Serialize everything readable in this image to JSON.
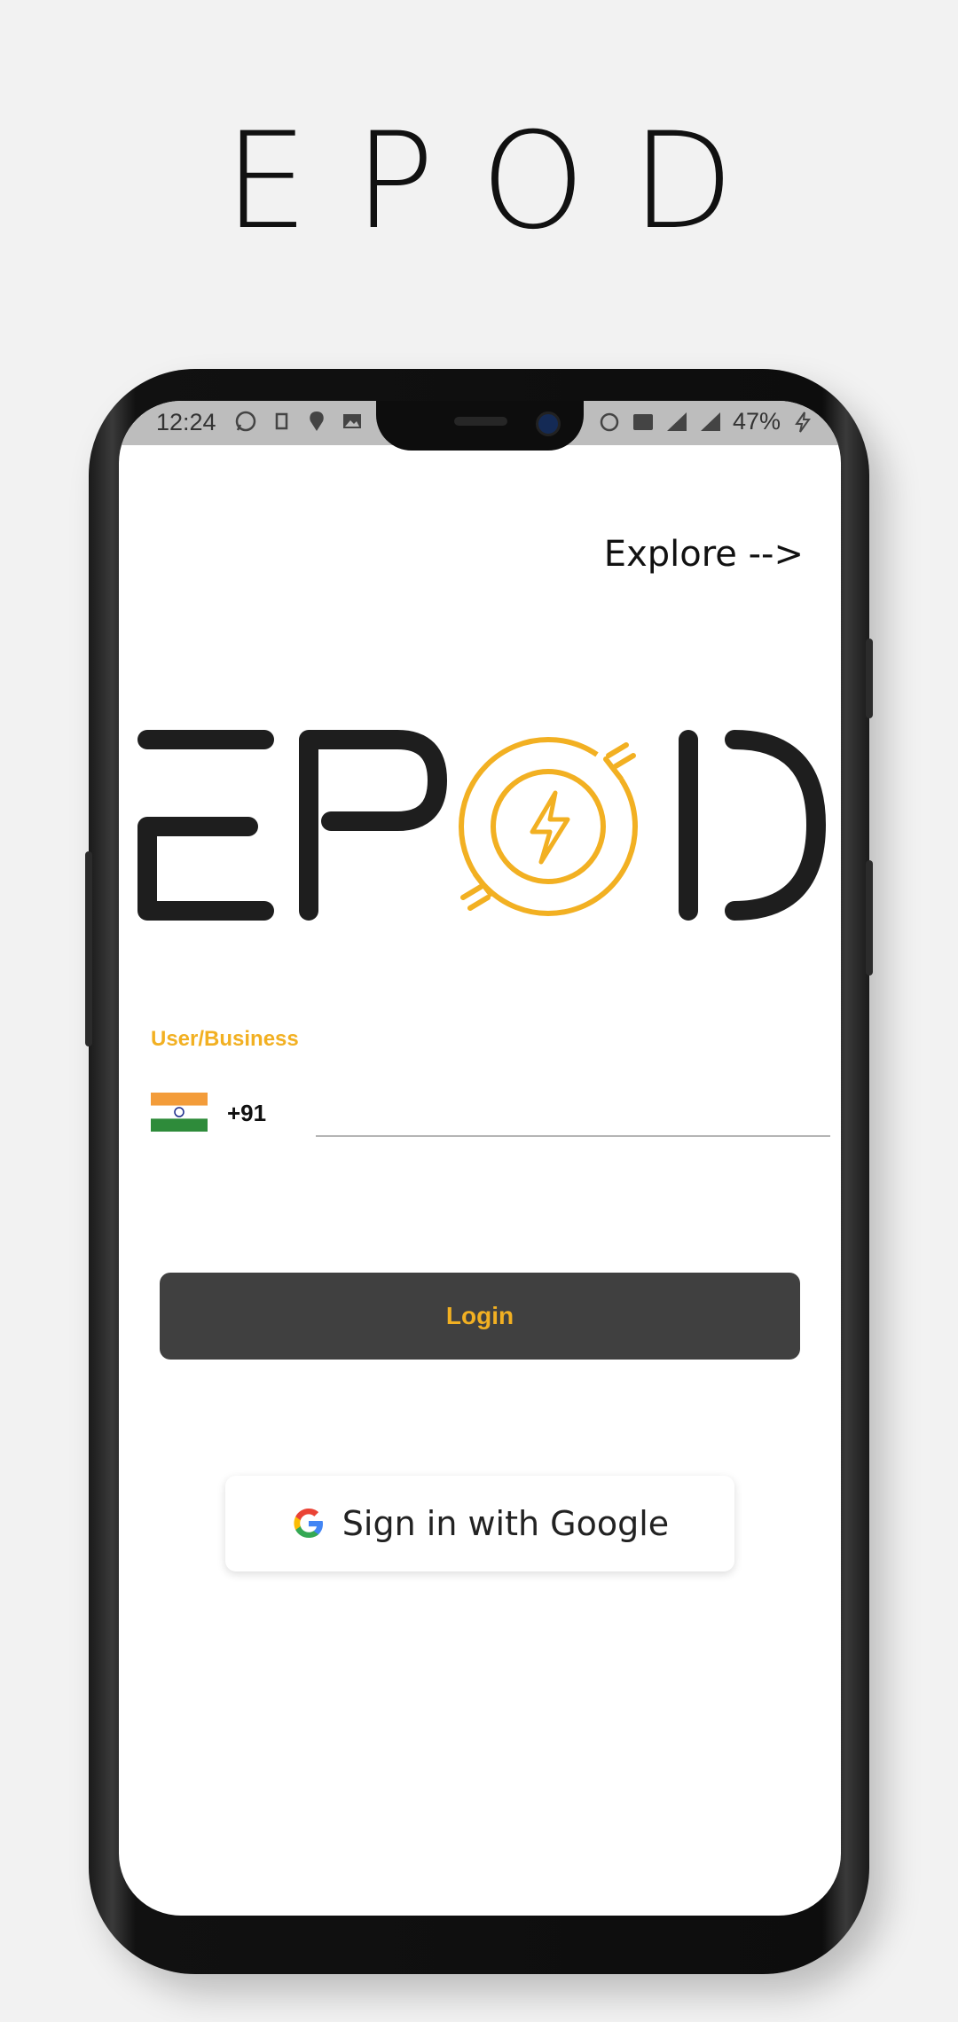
{
  "promo": {
    "title": "EPOD"
  },
  "status_bar": {
    "time": "12:24",
    "battery": "47%",
    "icons_left": [
      "whatsapp-icon",
      "sim-icon",
      "swiggy-icon",
      "image-icon"
    ],
    "icons_right": [
      "sync-icon",
      "volte-icon",
      "signal-icon",
      "signal-4g-icon",
      "charging-icon"
    ]
  },
  "header": {
    "explore_label": "Explore -->"
  },
  "logo": {
    "alt": "EPOD",
    "brand_color": "#f2b022",
    "dark_color": "#1e1e1e"
  },
  "form": {
    "field_label": "User/Business",
    "country_code": "+91",
    "phone_value": "",
    "flag": "india-flag-icon"
  },
  "actions": {
    "login_label": "Login",
    "google_label": "Sign in with Google"
  },
  "colors": {
    "accent": "#f2b022",
    "button_dark": "#404040",
    "background": "#f2f2f2"
  }
}
